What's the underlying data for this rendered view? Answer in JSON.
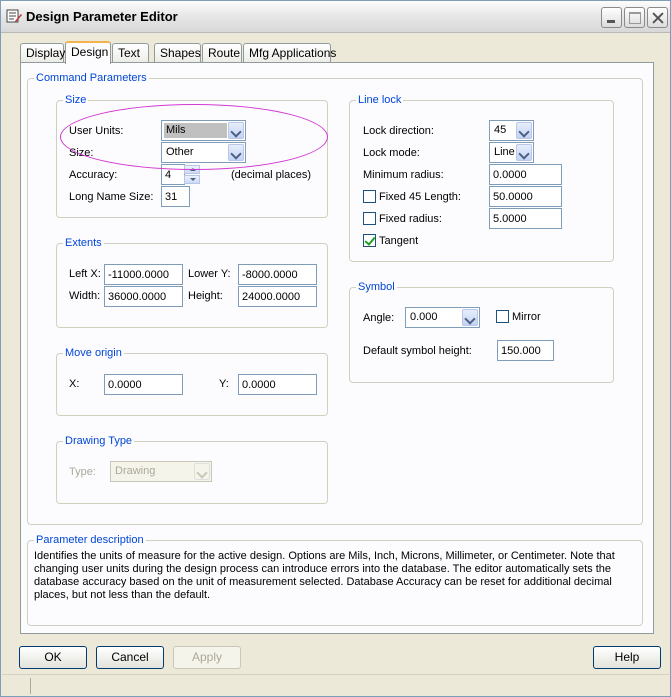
{
  "window": {
    "title": "Design Parameter Editor"
  },
  "tabs": [
    {
      "label": "Display"
    },
    {
      "label": "Design"
    },
    {
      "label": "Text"
    },
    {
      "label": "Shapes"
    },
    {
      "label": "Route"
    },
    {
      "label": "Mfg Applications"
    }
  ],
  "command_parameters": {
    "legend": "Command Parameters",
    "size": {
      "legend": "Size",
      "user_units_label": "User Units:",
      "user_units_value": "Mils",
      "size_label": "Size:",
      "size_value": "Other",
      "accuracy_label": "Accuracy:",
      "accuracy_value": "4",
      "accuracy_suffix": "(decimal places)",
      "long_name_label": "Long Name Size:",
      "long_name_value": "31"
    },
    "extents": {
      "legend": "Extents",
      "left_x_label": "Left X:",
      "left_x_value": "-11000.0000",
      "lower_y_label": "Lower Y:",
      "lower_y_value": "-8000.0000",
      "width_label": "Width:",
      "width_value": "36000.0000",
      "height_label": "Height:",
      "height_value": "24000.0000"
    },
    "move_origin": {
      "legend": "Move origin",
      "x_label": "X:",
      "x_value": "0.0000",
      "y_label": "Y:",
      "y_value": "0.0000"
    },
    "drawing_type": {
      "legend": "Drawing Type",
      "type_label": "Type:",
      "type_value": "Drawing"
    },
    "line_lock": {
      "legend": "Line lock",
      "lock_direction_label": "Lock direction:",
      "lock_direction_value": "45",
      "lock_mode_label": "Lock mode:",
      "lock_mode_value": "Line",
      "min_radius_label": "Minimum radius:",
      "min_radius_value": "0.0000",
      "fixed45_label": "Fixed 45 Length:",
      "fixed45_checked": false,
      "fixed45_value": "50.0000",
      "fixed_radius_label": "Fixed radius:",
      "fixed_radius_checked": false,
      "fixed_radius_value": "5.0000",
      "tangent_label": "Tangent",
      "tangent_checked": true
    },
    "symbol": {
      "legend": "Symbol",
      "angle_label": "Angle:",
      "angle_value": "0.000",
      "mirror_label": "Mirror",
      "mirror_checked": false,
      "default_height_label": "Default symbol height:",
      "default_height_value": "150.000"
    }
  },
  "parameter_description": {
    "legend": "Parameter description",
    "text": "Identifies the units of measure for the active design. Options are Mils, Inch, Microns, Millimeter, or Centimeter. Note that changing user units during the design process can introduce errors into the database.  The editor automatically sets the database accuracy based on the unit of measurement selected. Database Accuracy can be reset for additional decimal places, but not less than the default."
  },
  "buttons": {
    "ok": "OK",
    "cancel": "Cancel",
    "apply": "Apply",
    "help": "Help"
  },
  "colors": {
    "group_legend": "#0046d5",
    "annotation_ellipse": "#d23ad2",
    "active_tab_accent": "#f5b34c"
  }
}
